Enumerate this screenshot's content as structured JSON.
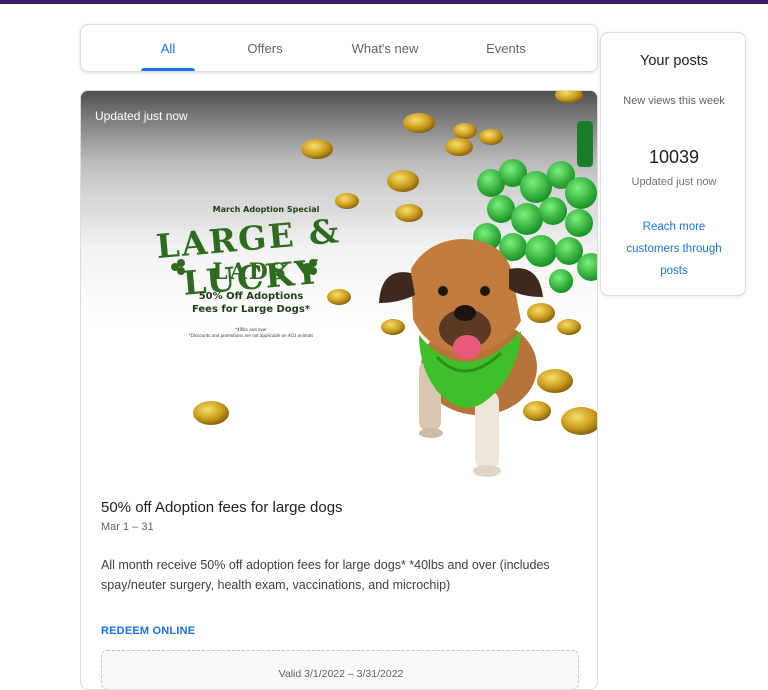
{
  "tabs": [
    {
      "label": "All",
      "active": true
    },
    {
      "label": "Offers",
      "active": false
    },
    {
      "label": "What's new",
      "active": false
    },
    {
      "label": "Events",
      "active": false
    }
  ],
  "post": {
    "updated": "Updated just now",
    "image": {
      "subtitle": "March Adoption Special",
      "headline_1": "LARGE & LUCKY",
      "headline_2": "LADS",
      "offer_line_1": "50% Off Adoptions",
      "offer_line_2": "Fees for Large Dogs*",
      "fine_print_1": "*40lbs and over",
      "fine_print_2": "*Discounts and promotions are not applicable on ACU animals"
    },
    "title": "50% off Adoption fees for large dogs",
    "date": "Mar 1 – 31",
    "description": "All month receive 50% off adoption fees for large dogs* *40lbs and over (includes spay/neuter surgery, health exam, vaccinations, and microchip)",
    "redeem_label": "REDEEM ONLINE",
    "valid_text": "Valid 3/1/2022 – 3/31/2022"
  },
  "sidebar": {
    "title": "Your posts",
    "views_label": "New views this week",
    "views_count": "10039",
    "updated": "Updated just now",
    "link": "Reach more customers through posts"
  },
  "colors": {
    "accent": "#1a73e8",
    "top_bar": "#3b1f6e",
    "headline_green": "#2e6b1f",
    "bandana_green": "#3fbf2a"
  }
}
